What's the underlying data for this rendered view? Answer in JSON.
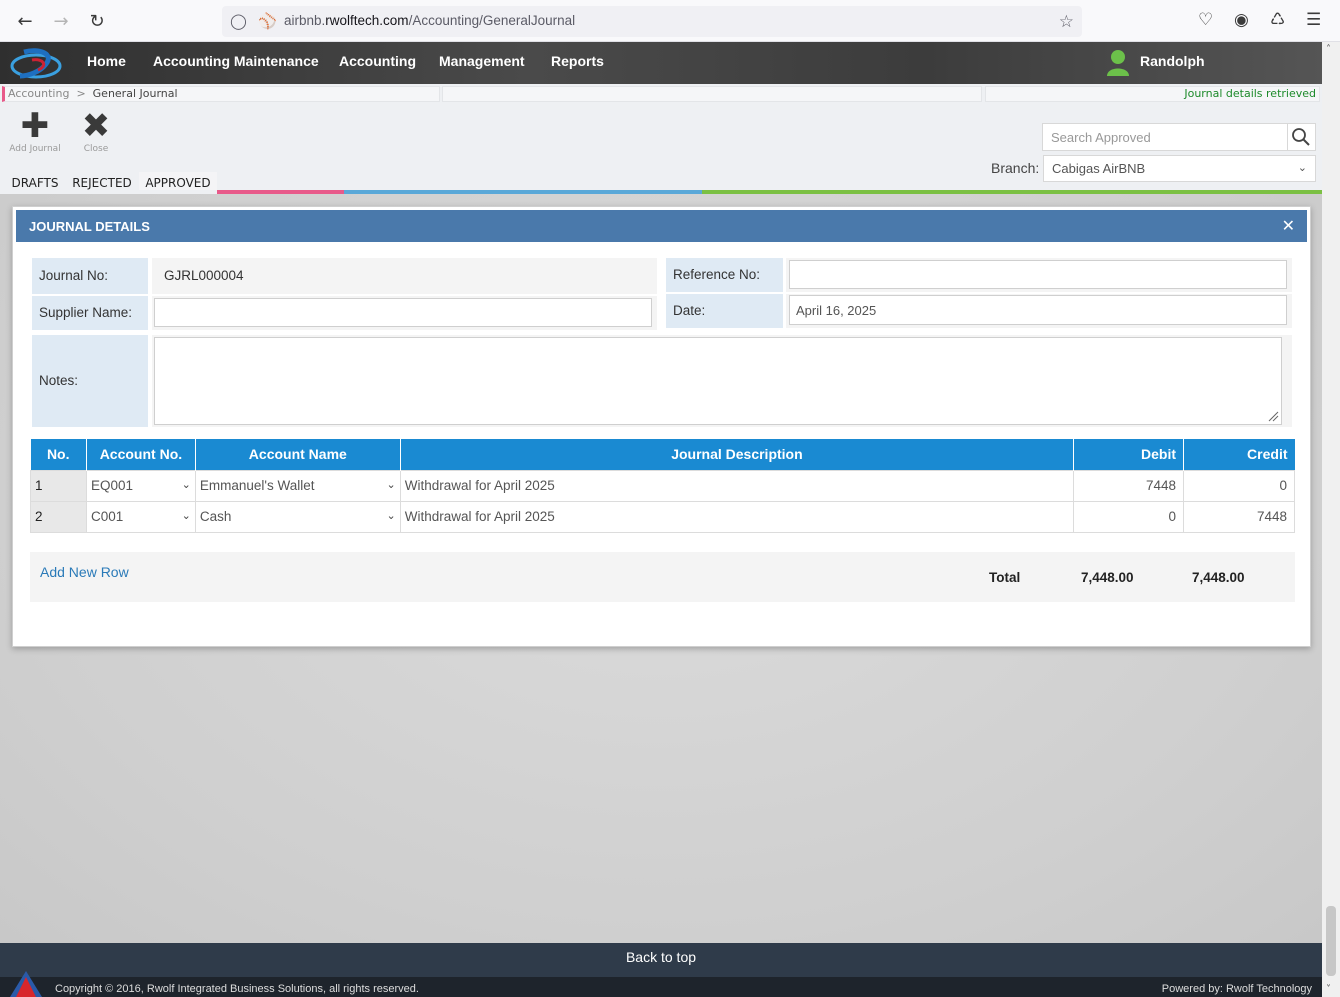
{
  "browser": {
    "url_domain": "airbnb.",
    "url_host": "rwolftech.com",
    "url_path": "/Accounting/GeneralJournal"
  },
  "nav": {
    "items": [
      "Home",
      "Accounting Maintenance",
      "Accounting",
      "Management",
      "Reports"
    ],
    "user": "Randolph"
  },
  "breadcrumb": {
    "parent": "Accounting",
    "separator": ">",
    "current": "General Journal",
    "status": "Journal details retrieved"
  },
  "toolbar": {
    "add_label": "Add Journal",
    "close_label": "Close",
    "search_placeholder": "Search Approved",
    "branch_label": "Branch:",
    "branch_value": "Cabigas AirBNB"
  },
  "tabs": [
    "DRAFTS",
    "REJECTED",
    "APPROVED"
  ],
  "colors": {
    "tab_drafts": "#f0b400",
    "tab_rejected": "#e85a8a",
    "tab_approved": "#e85a8a",
    "bar_blue": "#5aa8d8",
    "bar_green": "#7bc043",
    "header_blue": "#4a79ab",
    "table_blue": "#1a8ad2"
  },
  "modal": {
    "title": "JOURNAL DETAILS",
    "journal_no_label": "Journal No:",
    "journal_no": "GJRL000004",
    "reference_label": "Reference No:",
    "reference_value": "",
    "supplier_label": "Supplier Name:",
    "supplier_value": "",
    "date_label": "Date:",
    "date_value": "April 16, 2025",
    "notes_label": "Notes:",
    "notes_value": ""
  },
  "table": {
    "headers": [
      "No.",
      "Account No.",
      "Account Name",
      "Journal Description",
      "Debit",
      "Credit"
    ],
    "rows": [
      {
        "no": "1",
        "account_no": "EQ001",
        "account_name": "Emmanuel's Wallet",
        "description": "Withdrawal for April 2025",
        "debit": "7448",
        "credit": "0"
      },
      {
        "no": "2",
        "account_no": "C001",
        "account_name": "Cash",
        "description": "Withdrawal for April 2025",
        "debit": "0",
        "credit": "7448"
      }
    ],
    "add_row": "Add New Row",
    "total_label": "Total",
    "total_debit": "7,448.00",
    "total_credit": "7,448.00"
  },
  "footer": {
    "back_to_top": "Back to top",
    "copyright": "Copyright © 2016, Rwolf Integrated Business Solutions, all rights reserved.",
    "powered": "Powered by: Rwolf Technology"
  }
}
